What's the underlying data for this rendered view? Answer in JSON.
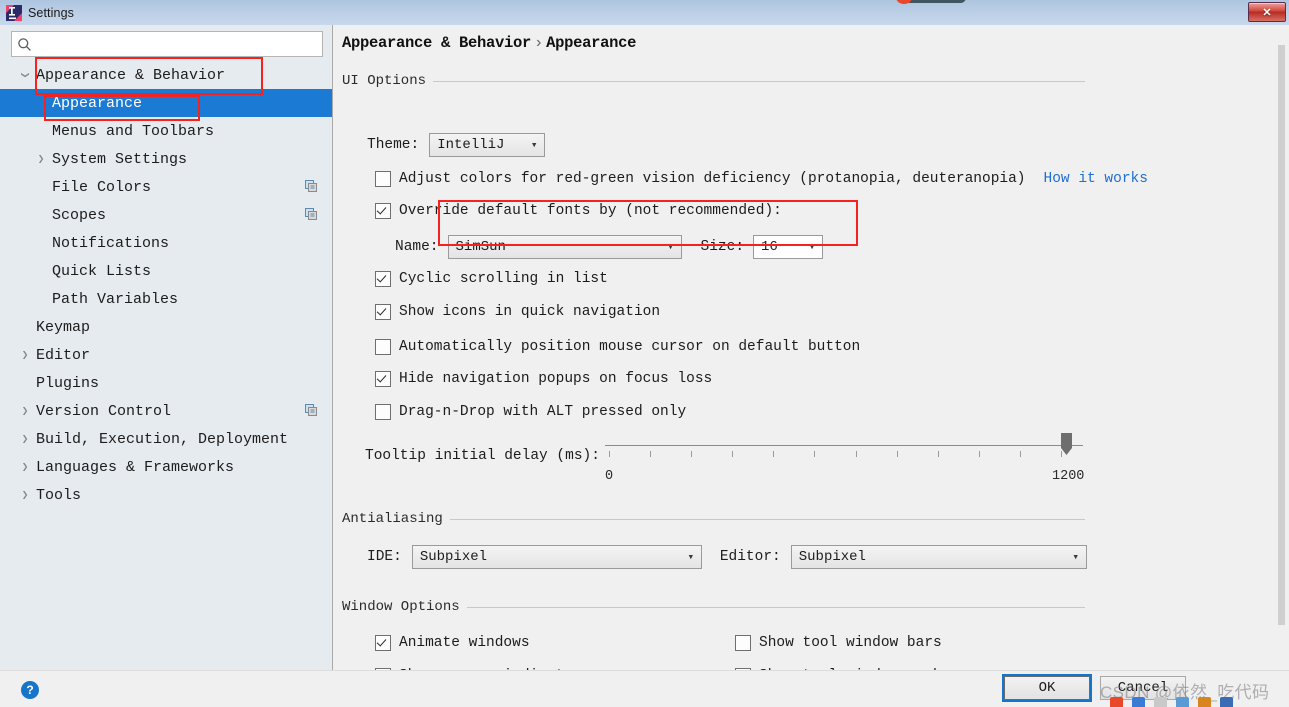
{
  "window": {
    "title": "Settings",
    "app_icon": "intellij-idea-icon",
    "close_label": "✕"
  },
  "sidebar": {
    "search": {
      "placeholder": "",
      "value": "",
      "icon": "search-icon"
    },
    "items": [
      {
        "label": "Appearance & Behavior",
        "depth": 0,
        "arrow": "expanded",
        "selected": false,
        "copy_icon": false
      },
      {
        "label": "Appearance",
        "depth": 1,
        "arrow": "none",
        "selected": true,
        "copy_icon": false
      },
      {
        "label": "Menus and Toolbars",
        "depth": 1,
        "arrow": "none",
        "selected": false,
        "copy_icon": false
      },
      {
        "label": "System Settings",
        "depth": 1,
        "arrow": "collapsed",
        "selected": false,
        "copy_icon": false
      },
      {
        "label": "File Colors",
        "depth": 1,
        "arrow": "none",
        "selected": false,
        "copy_icon": true
      },
      {
        "label": "Scopes",
        "depth": 1,
        "arrow": "none",
        "selected": false,
        "copy_icon": true
      },
      {
        "label": "Notifications",
        "depth": 1,
        "arrow": "none",
        "selected": false,
        "copy_icon": false
      },
      {
        "label": "Quick Lists",
        "depth": 1,
        "arrow": "none",
        "selected": false,
        "copy_icon": false
      },
      {
        "label": "Path Variables",
        "depth": 1,
        "arrow": "none",
        "selected": false,
        "copy_icon": false
      },
      {
        "label": "Keymap",
        "depth": 0,
        "arrow": "none",
        "selected": false,
        "copy_icon": false
      },
      {
        "label": "Editor",
        "depth": 0,
        "arrow": "collapsed",
        "selected": false,
        "copy_icon": false
      },
      {
        "label": "Plugins",
        "depth": 0,
        "arrow": "none",
        "selected": false,
        "copy_icon": false
      },
      {
        "label": "Version Control",
        "depth": 0,
        "arrow": "collapsed",
        "selected": false,
        "copy_icon": true
      },
      {
        "label": "Build, Execution, Deployment",
        "depth": 0,
        "arrow": "collapsed",
        "selected": false,
        "copy_icon": false
      },
      {
        "label": "Languages & Frameworks",
        "depth": 0,
        "arrow": "collapsed",
        "selected": false,
        "copy_icon": false
      },
      {
        "label": "Tools",
        "depth": 0,
        "arrow": "collapsed",
        "selected": false,
        "copy_icon": false
      }
    ]
  },
  "breadcrumb": {
    "root": "Appearance & Behavior",
    "separator": "›",
    "current": "Appearance"
  },
  "ui_options": {
    "section_label": "UI Options",
    "theme_label": "Theme:",
    "theme_value": "IntelliJ",
    "adjust_colors": {
      "label": "Adjust colors for red-green vision deficiency (protanopia, deuteranopia)",
      "checked": false
    },
    "how_it_works_link": "How it works",
    "override_fonts": {
      "label": "Override default fonts by (not recommended):",
      "checked": true
    },
    "font_name_label": "Name:",
    "font_name_value": "SimSun",
    "font_size_label": "Size:",
    "font_size_value": "16",
    "checkboxes": [
      {
        "label": "Cyclic scrolling in list",
        "checked": true
      },
      {
        "label": "Show icons in quick navigation",
        "checked": true
      },
      {
        "label": "Automatically position mouse cursor on default button",
        "checked": false
      },
      {
        "label": "Hide navigation popups on focus loss",
        "checked": true
      },
      {
        "label": "Drag-n-Drop with ALT pressed only",
        "checked": false
      }
    ],
    "tooltip_delay": {
      "label": "Tooltip initial delay (ms):",
      "min": "0",
      "max": "1200",
      "value": 1200,
      "ticks": 12
    }
  },
  "antialiasing": {
    "section_label": "Antialiasing",
    "ide_label": "IDE:",
    "ide_value": "Subpixel",
    "editor_label": "Editor:",
    "editor_value": "Subpixel"
  },
  "window_options": {
    "section_label": "Window Options",
    "left_column": [
      {
        "label": "Animate windows",
        "checked": true
      },
      {
        "label": "Show memory indicator",
        "checked": false
      }
    ],
    "right_column": [
      {
        "label": "Show tool window bars",
        "checked": false
      },
      {
        "label": "Show tool window numbers",
        "checked": true
      }
    ]
  },
  "footer": {
    "help_icon": "question-mark-icon",
    "help_glyph": "?",
    "ok_label": "OK",
    "cancel_label": "Cancel"
  },
  "watermark": {
    "text": "CSDN @依然_吃代码"
  },
  "colors": {
    "selection_blue": "#1a7ad4",
    "annotation_red": "#f5231f",
    "link_blue": "#1f6fd0",
    "sidebar_bg": "#e6ebf0",
    "panel_bg": "#f0f0f0"
  }
}
